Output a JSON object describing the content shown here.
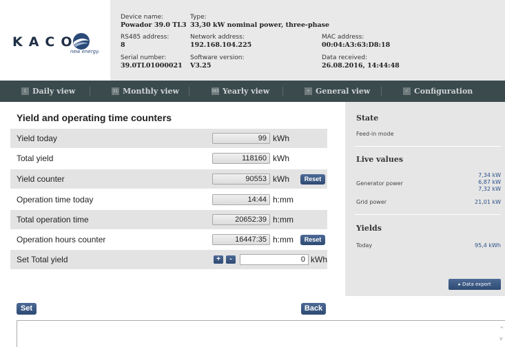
{
  "header": {
    "brand": "KACO",
    "tagline": "new energy.",
    "fields": {
      "device_name_label": "Device name:",
      "device_name": "Powador 39.0 TL3",
      "type_label": "Type:",
      "type": "33,30 kW nominal power, three-phase",
      "rs485_label": "RS485 address:",
      "rs485": "8",
      "network_label": "Network address:",
      "network": "192.168.104.225",
      "mac_label": "MAC address:",
      "mac": "00:04:A3:63:D8:18",
      "serial_label": "Serial number:",
      "serial": "39.0TL01000021",
      "software_label": "Software version:",
      "software": "V3.25",
      "received_label": "Data received:",
      "received": "26.08.2016, 14:44:48"
    }
  },
  "nav": {
    "items": [
      {
        "label": "Daily view",
        "icon": "calendar-day-icon",
        "glyph": "1"
      },
      {
        "label": "Monthly view",
        "icon": "calendar-month-icon",
        "glyph": "31"
      },
      {
        "label": "Yearly view",
        "icon": "calendar-year-icon",
        "glyph": "365"
      },
      {
        "label": "General view",
        "icon": "general-view-icon",
        "glyph": "+"
      },
      {
        "label": "Configuration",
        "icon": "configuration-icon",
        "glyph": "✓"
      }
    ]
  },
  "main": {
    "title": "Yield and operating time counters",
    "rows": [
      {
        "label": "Yield today",
        "value": "99",
        "unit": "kWh"
      },
      {
        "label": "Total yield",
        "value": "118160",
        "unit": "kWh"
      },
      {
        "label": "Yield counter",
        "value": "90553",
        "unit": "kWh",
        "action": "Reset"
      },
      {
        "label": "Operation time today",
        "value": "14:44",
        "unit": "h:mm"
      },
      {
        "label": "Total operation time",
        "value": "20652:39",
        "unit": "h:mm"
      },
      {
        "label": "Operation hours counter",
        "value": "16447:35",
        "unit": "h:mm",
        "action": "Reset"
      }
    ],
    "set_total": {
      "label": "Set Total yield",
      "plus": "+",
      "minus": "-",
      "value": "0",
      "unit": "kWh"
    },
    "set_button": "Set",
    "back_button": "Back"
  },
  "side": {
    "state_heading": "State",
    "state_value": "Feed-in mode",
    "live_heading": "Live values",
    "generator_label": "Generator power",
    "generator_values": [
      "7,34 kW",
      "6,87 kW",
      "7,32 kW"
    ],
    "grid_label": "Grid power",
    "grid_value": "21,01 kW",
    "yields_heading": "Yields",
    "today_label": "Today",
    "today_value": "95,4 kWh",
    "export_button": "▸ Data export"
  }
}
